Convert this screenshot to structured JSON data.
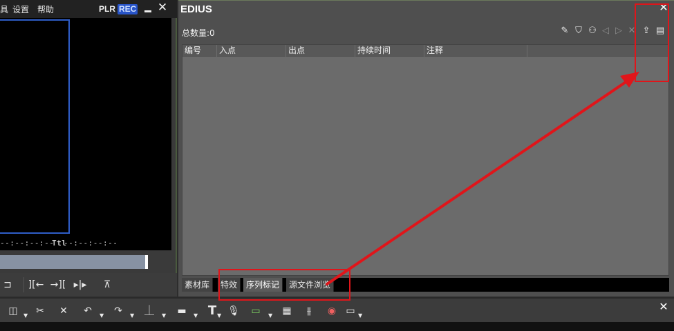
{
  "player": {
    "menu": {
      "item_partial": "具",
      "settings": "设置",
      "help": "帮助"
    },
    "mode_plr": "PLR",
    "mode_rec": "REC",
    "timecode_in": "--:--:--:--",
    "timecode_ttl_label": "Ttl",
    "timecode_ttl": "--:--:--:--",
    "controls": {
      "btn1": "⊐",
      "btn2": "][←",
      "btn3": "→][",
      "btn4": "▸|▸",
      "btn5": "⊼"
    }
  },
  "edius_window": {
    "title": "EDIUS",
    "total_label": "总数量:0",
    "columns": [
      "编号",
      "入点",
      "出点",
      "持续时间",
      "注释"
    ],
    "tabs": [
      "素材库",
      "特效",
      "序列标记",
      "源文件浏览"
    ],
    "active_tab": "序列标记",
    "toolbar_icons": [
      "edit-marker-icon",
      "add-marker-icon",
      "clear-marker-icon",
      "prev-marker-icon",
      "next-marker-icon",
      "delete-marker-icon",
      "export-marker-icon",
      "save-marker-icon"
    ]
  },
  "timeline_toolbar": {
    "icons": [
      "open-project-icon",
      "razor-icon",
      "delete-gap-icon",
      "undo-icon",
      "redo-icon",
      "ripple-icon",
      "sync-icon",
      "title-icon",
      "mic-icon",
      "render-icon",
      "grid-icon",
      "mixer-icon",
      "color-icon",
      "window-icon"
    ]
  },
  "colors": {
    "annotation": "#e0151a",
    "rec_badge": "#2854c8",
    "safe_frame": "#2f5ec9"
  }
}
